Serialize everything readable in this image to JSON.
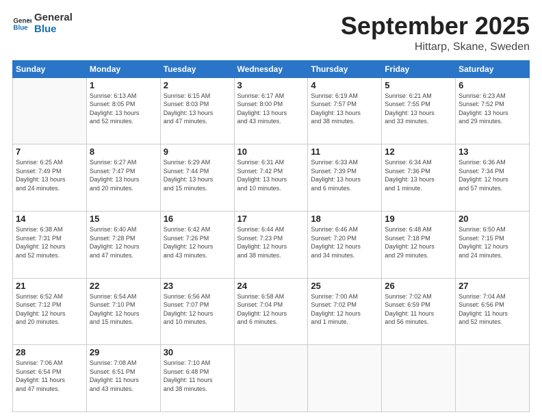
{
  "logo": {
    "line1": "General",
    "line2": "Blue"
  },
  "header": {
    "month": "September 2025",
    "location": "Hittarp, Skane, Sweden"
  },
  "days_of_week": [
    "Sunday",
    "Monday",
    "Tuesday",
    "Wednesday",
    "Thursday",
    "Friday",
    "Saturday"
  ],
  "weeks": [
    [
      {
        "day": "",
        "info": ""
      },
      {
        "day": "1",
        "info": "Sunrise: 6:13 AM\nSunset: 8:05 PM\nDaylight: 13 hours\nand 52 minutes."
      },
      {
        "day": "2",
        "info": "Sunrise: 6:15 AM\nSunset: 8:03 PM\nDaylight: 13 hours\nand 47 minutes."
      },
      {
        "day": "3",
        "info": "Sunrise: 6:17 AM\nSunset: 8:00 PM\nDaylight: 13 hours\nand 43 minutes."
      },
      {
        "day": "4",
        "info": "Sunrise: 6:19 AM\nSunset: 7:57 PM\nDaylight: 13 hours\nand 38 minutes."
      },
      {
        "day": "5",
        "info": "Sunrise: 6:21 AM\nSunset: 7:55 PM\nDaylight: 13 hours\nand 33 minutes."
      },
      {
        "day": "6",
        "info": "Sunrise: 6:23 AM\nSunset: 7:52 PM\nDaylight: 13 hours\nand 29 minutes."
      }
    ],
    [
      {
        "day": "7",
        "info": "Sunrise: 6:25 AM\nSunset: 7:49 PM\nDaylight: 13 hours\nand 24 minutes."
      },
      {
        "day": "8",
        "info": "Sunrise: 6:27 AM\nSunset: 7:47 PM\nDaylight: 13 hours\nand 20 minutes."
      },
      {
        "day": "9",
        "info": "Sunrise: 6:29 AM\nSunset: 7:44 PM\nDaylight: 13 hours\nand 15 minutes."
      },
      {
        "day": "10",
        "info": "Sunrise: 6:31 AM\nSunset: 7:42 PM\nDaylight: 13 hours\nand 10 minutes."
      },
      {
        "day": "11",
        "info": "Sunrise: 6:33 AM\nSunset: 7:39 PM\nDaylight: 13 hours\nand 6 minutes."
      },
      {
        "day": "12",
        "info": "Sunrise: 6:34 AM\nSunset: 7:36 PM\nDaylight: 13 hours\nand 1 minute."
      },
      {
        "day": "13",
        "info": "Sunrise: 6:36 AM\nSunset: 7:34 PM\nDaylight: 12 hours\nand 57 minutes."
      }
    ],
    [
      {
        "day": "14",
        "info": "Sunrise: 6:38 AM\nSunset: 7:31 PM\nDaylight: 12 hours\nand 52 minutes."
      },
      {
        "day": "15",
        "info": "Sunrise: 6:40 AM\nSunset: 7:28 PM\nDaylight: 12 hours\nand 47 minutes."
      },
      {
        "day": "16",
        "info": "Sunrise: 6:42 AM\nSunset: 7:26 PM\nDaylight: 12 hours\nand 43 minutes."
      },
      {
        "day": "17",
        "info": "Sunrise: 6:44 AM\nSunset: 7:23 PM\nDaylight: 12 hours\nand 38 minutes."
      },
      {
        "day": "18",
        "info": "Sunrise: 6:46 AM\nSunset: 7:20 PM\nDaylight: 12 hours\nand 34 minutes."
      },
      {
        "day": "19",
        "info": "Sunrise: 6:48 AM\nSunset: 7:18 PM\nDaylight: 12 hours\nand 29 minutes."
      },
      {
        "day": "20",
        "info": "Sunrise: 6:50 AM\nSunset: 7:15 PM\nDaylight: 12 hours\nand 24 minutes."
      }
    ],
    [
      {
        "day": "21",
        "info": "Sunrise: 6:52 AM\nSunset: 7:12 PM\nDaylight: 12 hours\nand 20 minutes."
      },
      {
        "day": "22",
        "info": "Sunrise: 6:54 AM\nSunset: 7:10 PM\nDaylight: 12 hours\nand 15 minutes."
      },
      {
        "day": "23",
        "info": "Sunrise: 6:56 AM\nSunset: 7:07 PM\nDaylight: 12 hours\nand 10 minutes."
      },
      {
        "day": "24",
        "info": "Sunrise: 6:58 AM\nSunset: 7:04 PM\nDaylight: 12 hours\nand 6 minutes."
      },
      {
        "day": "25",
        "info": "Sunrise: 7:00 AM\nSunset: 7:02 PM\nDaylight: 12 hours\nand 1 minute."
      },
      {
        "day": "26",
        "info": "Sunrise: 7:02 AM\nSunset: 6:59 PM\nDaylight: 11 hours\nand 56 minutes."
      },
      {
        "day": "27",
        "info": "Sunrise: 7:04 AM\nSunset: 6:56 PM\nDaylight: 11 hours\nand 52 minutes."
      }
    ],
    [
      {
        "day": "28",
        "info": "Sunrise: 7:06 AM\nSunset: 6:54 PM\nDaylight: 11 hours\nand 47 minutes."
      },
      {
        "day": "29",
        "info": "Sunrise: 7:08 AM\nSunset: 6:51 PM\nDaylight: 11 hours\nand 43 minutes."
      },
      {
        "day": "30",
        "info": "Sunrise: 7:10 AM\nSunset: 6:48 PM\nDaylight: 11 hours\nand 38 minutes."
      },
      {
        "day": "",
        "info": ""
      },
      {
        "day": "",
        "info": ""
      },
      {
        "day": "",
        "info": ""
      },
      {
        "day": "",
        "info": ""
      }
    ]
  ]
}
